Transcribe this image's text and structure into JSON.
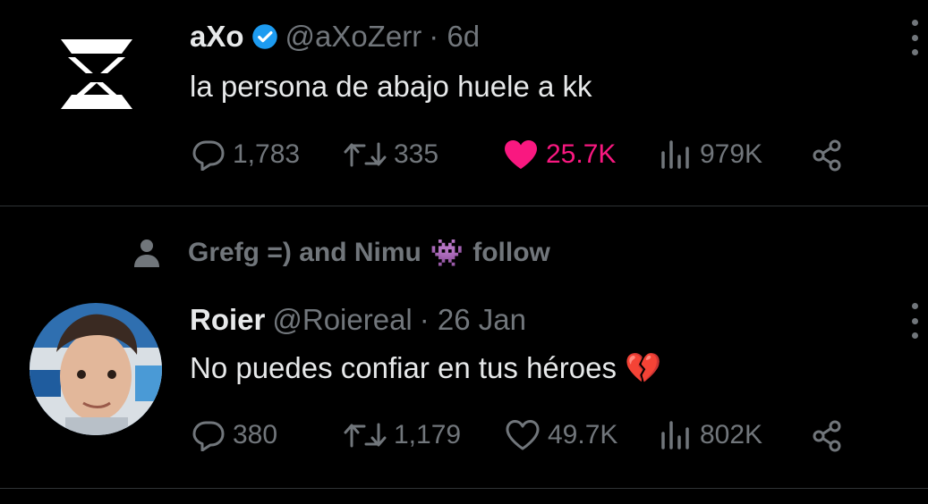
{
  "tweet1": {
    "name": "aXo",
    "handle": "@aXoZerr",
    "time": "· 6d",
    "text": "la persona de abajo huele a kk",
    "replies": "1,783",
    "retweets": "335",
    "likes": "25.7K",
    "views": "979K",
    "liked": true,
    "verified": true
  },
  "social_context": {
    "text": "Grefg =) and Nimu",
    "emoji": "👾",
    "follow": "follow"
  },
  "tweet2": {
    "name": "Roier",
    "handle": "@Roiereal",
    "time": "· 26 Jan",
    "text": "No puedes confiar en tus héroes",
    "emoji": "💔",
    "replies": "380",
    "retweets": "1,179",
    "likes": "49.7K",
    "views": "802K"
  },
  "colors": {
    "background": "#000000",
    "text": "#e7e9ea",
    "muted": "#71767b",
    "like": "#f91880",
    "verified": "#1d9bf0"
  }
}
